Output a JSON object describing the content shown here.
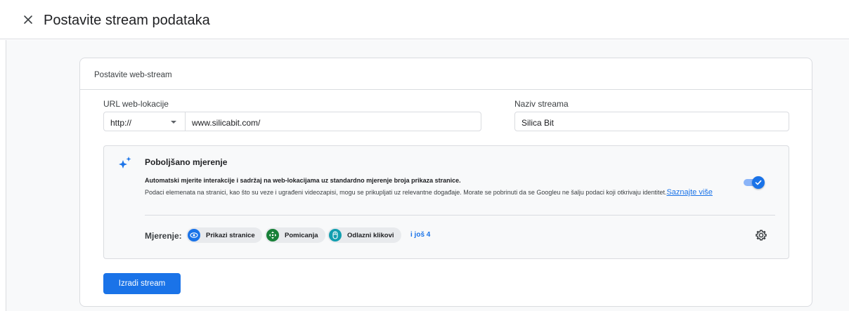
{
  "header": {
    "title": "Postavite stream podataka",
    "close_icon": "close-icon"
  },
  "card": {
    "title": "Postavite web-stream",
    "url_label": "URL web-lokacije",
    "protocol": "http://",
    "url_value": "www.silicabit.com/",
    "name_label": "Naziv streama",
    "name_value": "Silica Bit"
  },
  "enhanced": {
    "title": "Poboljšano mjerenje",
    "desc_bold": "Automatski mjerite interakcije i sadržaj na web-lokacijama uz standardno mjerenje broja prikaza stranice.",
    "desc": "Podaci elemenata na stranici, kao što su veze i ugrađeni videozapisi, mogu se prikupljati uz relevantne događaje. Morate se pobrinuti da se Googleu ne šalju podaci koji otkrivaju identitet.",
    "link": "Saznajte više",
    "enabled": true,
    "measure_label": "Mjerenje:",
    "chips": [
      {
        "label": "Prikazi stranice",
        "icon": "eye-icon",
        "color": "#1a73e8"
      },
      {
        "label": "Pomicanja",
        "icon": "scroll-arrows-icon",
        "color": "#188038"
      },
      {
        "label": "Odlazni klikovi",
        "icon": "mouse-icon",
        "color": "#129eaf"
      }
    ],
    "more": "i još 4"
  },
  "actions": {
    "create_label": "Izradi stream"
  },
  "colors": {
    "accent": "#1a73e8",
    "border": "#dadce0",
    "panel_bg": "#f8f9fa"
  }
}
